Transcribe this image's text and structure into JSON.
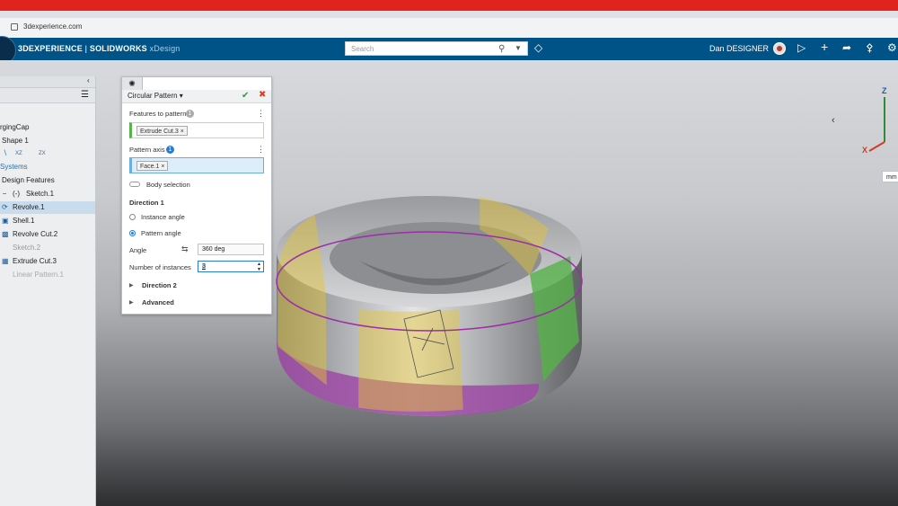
{
  "browser": {
    "url": "3dexperience.com"
  },
  "app": {
    "brand": "3DEXPERIENCE",
    "separator": "|",
    "product": "SOLIDWORKS",
    "suffix": "xDesign",
    "search_placeholder": "Search",
    "user": "Dan DESIGNER"
  },
  "tree": {
    "root": "rgingCap",
    "items": [
      {
        "label": "Shape 1"
      },
      {
        "label": "Systems"
      },
      {
        "label": "Design Features"
      },
      {
        "label": "Sketch.1",
        "prefix": "(-)"
      },
      {
        "label": "Revolve.1",
        "selected": true
      },
      {
        "label": "Shell.1"
      },
      {
        "label": "Revolve Cut.2"
      },
      {
        "label": "Sketch.2"
      },
      {
        "label": "Extrude Cut.3"
      },
      {
        "label": "Linear Pattern.1"
      }
    ],
    "plane_labels": [
      "XZ",
      "ZX"
    ]
  },
  "dialog": {
    "title": "Circular Pattern",
    "features_label": "Features to pattern",
    "features_count": "1",
    "feature_chip": "Extrude Cut.3",
    "axis_label": "Pattern axis",
    "axis_count": "1",
    "axis_chip": "Face.1",
    "body_selection": "Body selection",
    "direction1": "Direction 1",
    "instance_angle": "Instance angle",
    "pattern_angle": "Pattern angle",
    "angle_label": "Angle",
    "angle_value": "360 deg",
    "instances_label": "Number of instances",
    "instances_value": "3",
    "direction2": "Direction 2",
    "advanced": "Advanced"
  },
  "viewport": {
    "triad_z": "Z",
    "triad_x": "X",
    "unit": "mm"
  },
  "colors": {
    "appbar": "#005386",
    "selected_row": "#c8dcee",
    "feature_green": "#56b24a",
    "axis_purple": "#9c2ea6",
    "highlight_yellow": "#e6c531"
  }
}
